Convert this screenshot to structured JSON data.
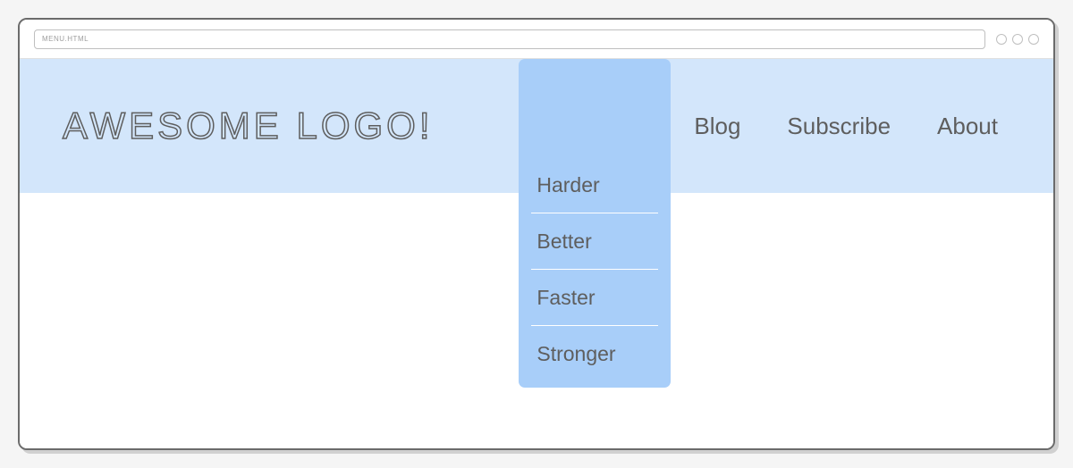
{
  "browser": {
    "address": "MENU.HTML"
  },
  "header": {
    "logo": "Awesome Logo!"
  },
  "nav": {
    "items": [
      {
        "label": ""
      },
      {
        "label": "Blog"
      },
      {
        "label": "Subscribe"
      },
      {
        "label": "About"
      }
    ],
    "dropdown": [
      {
        "label": "Harder"
      },
      {
        "label": "Better"
      },
      {
        "label": "Faster"
      },
      {
        "label": "Stronger"
      }
    ]
  },
  "colors": {
    "headerBg": "#d3e6fb",
    "dropdownBg": "#a8cef9",
    "text": "#5e5e5e"
  }
}
